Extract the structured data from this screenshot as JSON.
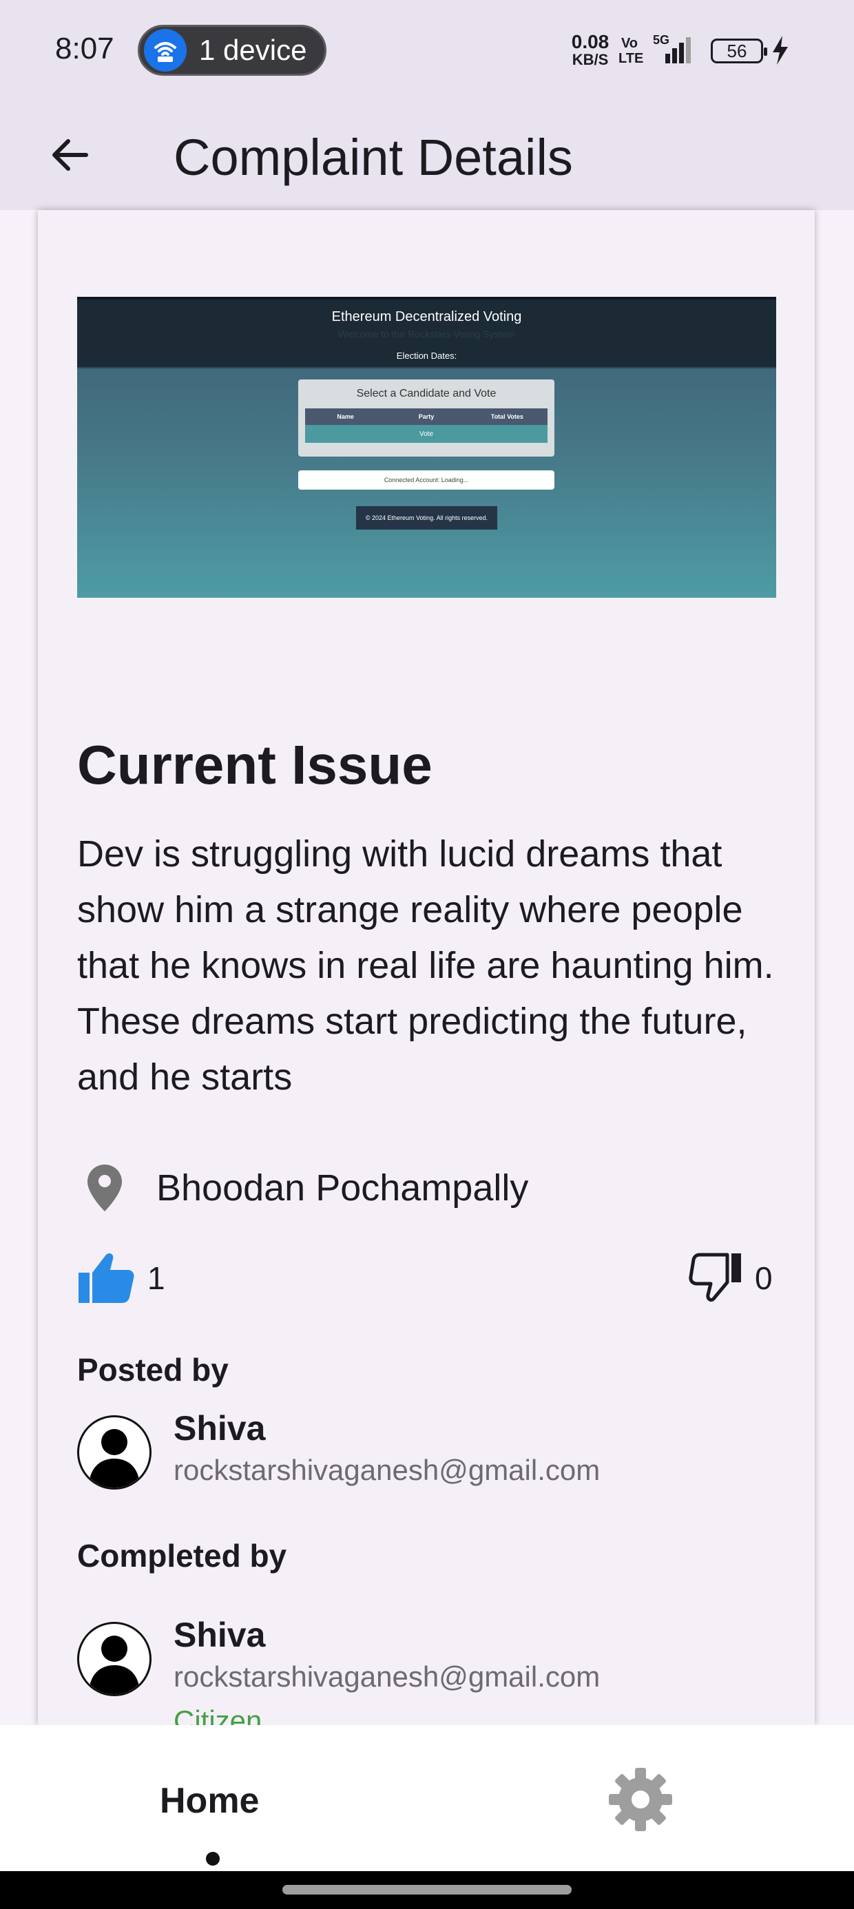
{
  "status_bar": {
    "time": "8:07",
    "hotspot_label": "1 device",
    "net_speed_value": "0.08",
    "net_speed_unit": "KB/S",
    "volte_top": "Vo",
    "volte_bottom": "LTE",
    "network_type": "5G",
    "battery_level": "56",
    "icons": [
      "wifi-hotspot-icon",
      "signal-icon",
      "battery-icon",
      "charging-bolt-icon"
    ]
  },
  "app_bar": {
    "title": "Complaint Details",
    "back_icon": "arrow-back-icon"
  },
  "complaint": {
    "image": {
      "title": "Ethereum Decentralized Voting",
      "welcome": "Welcome to the Rockstars Voting System",
      "dates_label": "Election Dates:",
      "box_title": "Select a Candidate and Vote",
      "table_headers": [
        "Name",
        "Party",
        "Total Votes"
      ],
      "vote_button": "Vote",
      "account_text": "Connected Account: Loading...",
      "footer_text": "© 2024 Ethereum Voting. All rights reserved."
    },
    "section_title": "Current Issue",
    "description": "Dev is struggling with lucid dreams that show him a strange reality where people that he knows in real life are haunting him. These dreams start predicting the future, and he starts",
    "location": "Bhoodan Pochampally",
    "likes": "1",
    "dislikes": "0",
    "posted_by": {
      "heading": "Posted by",
      "name": "Shiva",
      "email": "rockstarshivaganesh@gmail.com"
    },
    "completed_by": {
      "heading": "Completed by",
      "name": "Shiva",
      "email": "rockstarshivaganesh@gmail.com",
      "role": "Citizen"
    }
  },
  "bottom_nav": {
    "home_label": "Home",
    "settings_icon": "gear-icon"
  },
  "colors": {
    "app_bar_bg": "#e8e3ef",
    "card_bg": "#f5f0f7",
    "like_blue": "#2a8be6",
    "role_green": "#43a047",
    "email_gray": "#6d6a70"
  }
}
